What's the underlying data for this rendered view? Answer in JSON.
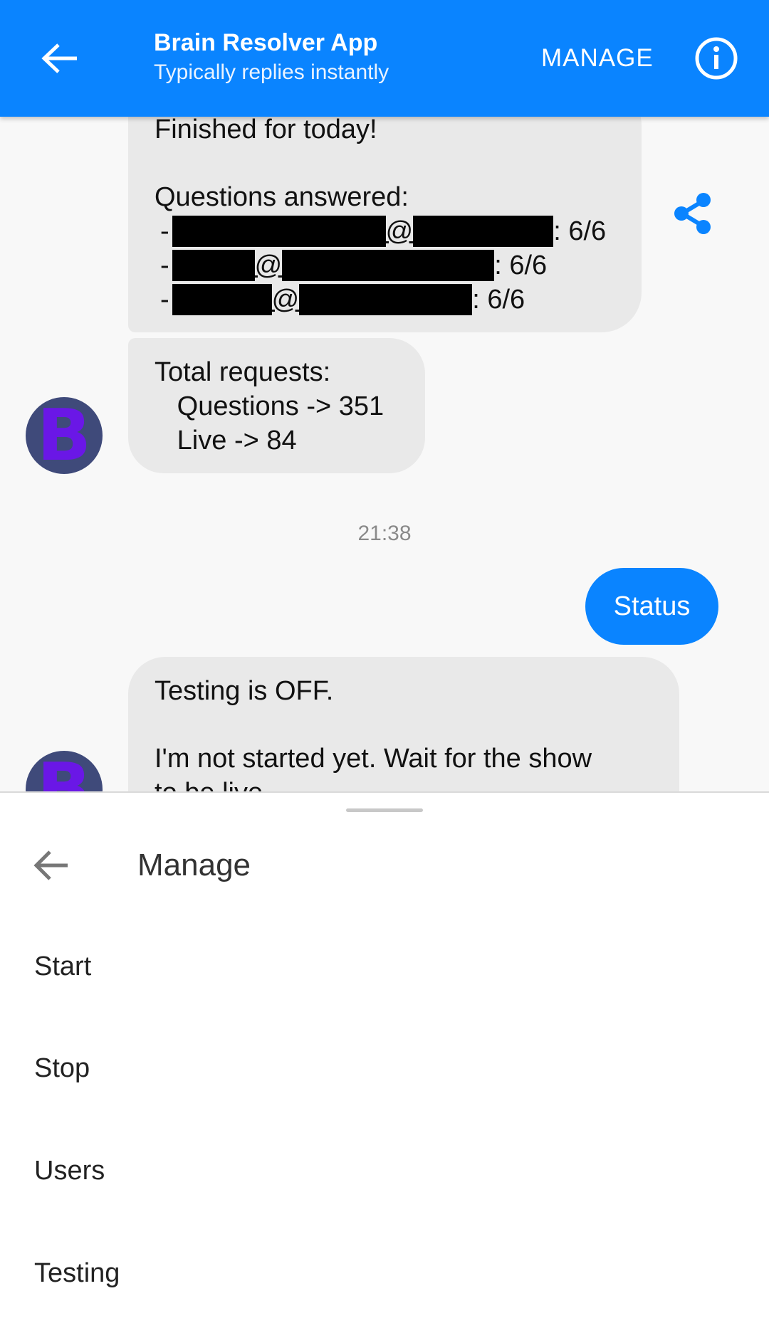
{
  "header": {
    "title": "Brain Resolver App",
    "subtitle": "Typically replies instantly",
    "manage_label": "MANAGE",
    "back_icon": "arrow-left-icon",
    "info_icon": "info-circle-icon",
    "color": "#0a84ff"
  },
  "chat": {
    "msg1": {
      "line1": "Finished for today!",
      "line2": "Questions answered:",
      "rows": [
        {
          "dash": "-",
          "at": "@",
          "score": ": 6/6"
        },
        {
          "dash": "-",
          "at": "@",
          "score": ": 6/6"
        },
        {
          "dash": "-",
          "at": "@",
          "score": ": 6/6"
        }
      ]
    },
    "msg2": {
      "line1": "Total requests:",
      "line2": "   Questions -> 351",
      "line3": "   Live -> 84"
    },
    "timestamp": "21:38",
    "sent": "Status",
    "msg3": {
      "line1": "Testing is OFF.",
      "line2": "I'm not started yet. Wait for the show",
      "line3": "to be live..."
    },
    "avatar_letter": "B",
    "share_icon": "share-icon"
  },
  "sheet": {
    "title": "Manage",
    "items": [
      "Start",
      "Stop",
      "Users",
      "Testing"
    ]
  }
}
